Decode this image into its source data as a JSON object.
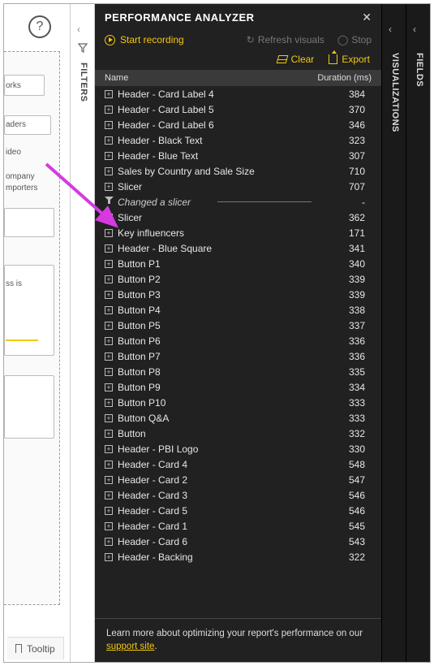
{
  "canvas": {
    "help_tooltip": "?",
    "snippets": [
      "orks",
      "aders",
      "ideo",
      "ompany",
      "mporters",
      "ss is"
    ],
    "tooltip_tab": "Tooltip"
  },
  "filters": {
    "label": "FILTERS"
  },
  "visualizations": {
    "label": "VISUALIZATIONS"
  },
  "fields": {
    "label": "FIELDS"
  },
  "panel": {
    "title": "PERFORMANCE ANALYZER",
    "start_recording": "Start recording",
    "refresh_visuals": "Refresh visuals",
    "stop": "Stop",
    "clear": "Clear",
    "export": "Export",
    "col_name": "Name",
    "col_duration": "Duration (ms)",
    "rows": [
      {
        "type": "item",
        "name": "Header - Card Label 4",
        "duration": "384"
      },
      {
        "type": "item",
        "name": "Header - Card Label 5",
        "duration": "370"
      },
      {
        "type": "item",
        "name": "Header - Card Label 6",
        "duration": "346"
      },
      {
        "type": "item",
        "name": "Header - Black Text",
        "duration": "323"
      },
      {
        "type": "item",
        "name": "Header - Blue Text",
        "duration": "307"
      },
      {
        "type": "item",
        "name": "Sales by Country and Sale Size",
        "duration": "710"
      },
      {
        "type": "item",
        "name": "Slicer",
        "duration": "707"
      },
      {
        "type": "event",
        "name": "Changed a slicer",
        "duration": "-"
      },
      {
        "type": "item",
        "name": "Slicer",
        "duration": "362"
      },
      {
        "type": "item",
        "name": "Key influencers",
        "duration": "171"
      },
      {
        "type": "item",
        "name": "Header - Blue Square",
        "duration": "341"
      },
      {
        "type": "item",
        "name": "Button P1",
        "duration": "340"
      },
      {
        "type": "item",
        "name": "Button P2",
        "duration": "339"
      },
      {
        "type": "item",
        "name": "Button P3",
        "duration": "339"
      },
      {
        "type": "item",
        "name": "Button P4",
        "duration": "338"
      },
      {
        "type": "item",
        "name": "Button P5",
        "duration": "337"
      },
      {
        "type": "item",
        "name": "Button P6",
        "duration": "336"
      },
      {
        "type": "item",
        "name": "Button P7",
        "duration": "336"
      },
      {
        "type": "item",
        "name": "Button P8",
        "duration": "335"
      },
      {
        "type": "item",
        "name": "Button P9",
        "duration": "334"
      },
      {
        "type": "item",
        "name": "Button P10",
        "duration": "333"
      },
      {
        "type": "item",
        "name": "Button Q&A",
        "duration": "333"
      },
      {
        "type": "item",
        "name": "Button",
        "duration": "332"
      },
      {
        "type": "item",
        "name": "Header - PBI Logo",
        "duration": "330"
      },
      {
        "type": "item",
        "name": "Header - Card 4",
        "duration": "548"
      },
      {
        "type": "item",
        "name": "Header - Card 2",
        "duration": "547"
      },
      {
        "type": "item",
        "name": "Header - Card 3",
        "duration": "546"
      },
      {
        "type": "item",
        "name": "Header - Card 5",
        "duration": "546"
      },
      {
        "type": "item",
        "name": "Header - Card 1",
        "duration": "545"
      },
      {
        "type": "item",
        "name": "Header - Card 6",
        "duration": "543"
      },
      {
        "type": "item",
        "name": "Header - Backing",
        "duration": "322"
      }
    ],
    "footer_prefix": "Learn more about optimizing your report's performance on our ",
    "footer_link": "support site",
    "footer_suffix": "."
  }
}
